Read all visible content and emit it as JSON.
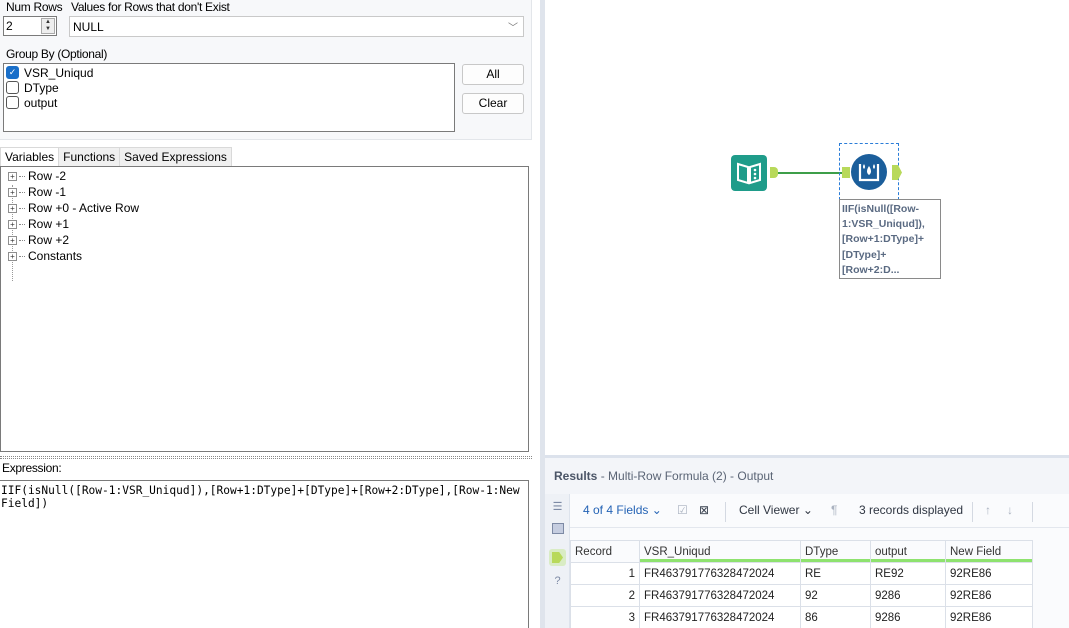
{
  "config": {
    "num_rows_label": "Num Rows",
    "num_rows_value": "2",
    "values_label": "Values for Rows that don't Exist",
    "values_selected": "NULL",
    "group_by_label": "Group By (Optional)",
    "group_by_fields": [
      {
        "label": "VSR_Uniqud",
        "checked": true
      },
      {
        "label": "DType",
        "checked": false
      },
      {
        "label": "output",
        "checked": false
      }
    ],
    "all_button": "All",
    "clear_button": "Clear"
  },
  "tabs": [
    "Variables",
    "Functions",
    "Saved Expressions"
  ],
  "variables_tree": [
    "Row -2",
    "Row -1",
    "Row +0 - Active Row",
    "Row +1",
    "Row +2",
    "Constants"
  ],
  "expression": {
    "label": "Expression:",
    "value": "IIF(isNull([Row-1:VSR_Uniqud]),[Row+1:DType]+[DType]+[Row+2:DType],[Row-1:New Field])"
  },
  "canvas": {
    "annotation": "IIF(isNull([Row-1:VSR_Uniqud]),[Row+1:DType]+[DType]+[Row+2:D..."
  },
  "results": {
    "title_bold": "Results",
    "title_rest": " - Multi-Row Formula (2) - Output",
    "fields_selector": "4 of 4 Fields",
    "cell_viewer": "Cell Viewer",
    "records_displayed": "3 records displayed",
    "columns": [
      "Record",
      "VSR_Uniqud",
      "DType",
      "output",
      "New Field"
    ],
    "rows": [
      [
        "1",
        "FR463791776328472024",
        "RE",
        "RE92",
        "92RE86"
      ],
      [
        "2",
        "FR463791776328472024",
        "92",
        "9286",
        "92RE86"
      ],
      [
        "3",
        "FR463791776328472024",
        "86",
        "9286",
        "92RE86"
      ]
    ]
  },
  "colors": {
    "accent_blue": "#1a6fc9",
    "tool_teal": "#1f9c8a",
    "tool_navy": "#1b5e9b",
    "anchor_green": "#b8d95a",
    "header_bar_green": "#8ee26e"
  }
}
